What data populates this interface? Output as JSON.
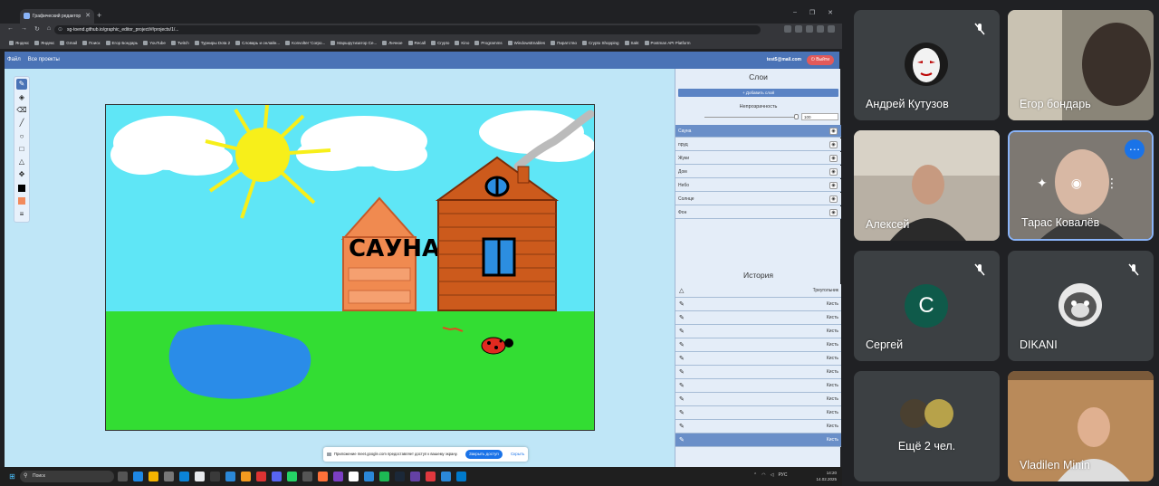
{
  "browser": {
    "tab_title": "Графический редактор",
    "url": "sg-toend.github.io/graphic_editor_project/#/projects/1/...",
    "bookmarks": [
      "Яндекс",
      "Яндекс",
      "Gmail",
      "Поиск",
      "Егор Бондарь",
      "YouTube",
      "Twitch",
      "Турниры Dota 2",
      "Словарь и онлайн...",
      "Konvolter 'Corpo...",
      "Маршрутизатор Се...",
      "Личное",
      "Recall",
      "Crypto",
      "Kino",
      "Programms",
      "WindowsEnables",
      "Пиратство",
      "Crypto Shopping",
      "Sakt",
      "Postman API Platform"
    ]
  },
  "app": {
    "menu": [
      "Файл",
      "Все проекты"
    ],
    "user_email": "test5@mail.com",
    "logout_label": "Выйти"
  },
  "toolbar": {
    "tools": [
      "brush-icon",
      "fill-icon",
      "eraser-icon",
      "line-icon",
      "circle-icon",
      "rectangle-icon",
      "triangle-icon",
      "move-icon",
      "primary-color",
      "secondary-color",
      "menu-icon"
    ],
    "primary_color": "#000000",
    "secondary_color": "#f28a5c"
  },
  "drawing": {
    "sauna_text": "САУНА"
  },
  "layers_panel": {
    "title": "Слои",
    "add_layer_label": "+ Добавить слой",
    "opacity_label": "Непрозрачность",
    "opacity_value": "100",
    "layers": [
      {
        "name": "Сауна",
        "selected": true
      },
      {
        "name": "пруд",
        "selected": false
      },
      {
        "name": "Жуки",
        "selected": false
      },
      {
        "name": "Дом",
        "selected": false
      },
      {
        "name": "Небо",
        "selected": false
      },
      {
        "name": "Солнце",
        "selected": false
      },
      {
        "name": "Фон",
        "selected": false
      }
    ]
  },
  "history_panel": {
    "title": "История",
    "items": [
      {
        "label": "Треугольник",
        "icon": "triangle-icon"
      },
      {
        "label": "Кисть",
        "icon": "brush-icon"
      },
      {
        "label": "Кисть",
        "icon": "brush-icon"
      },
      {
        "label": "Кисть",
        "icon": "brush-icon"
      },
      {
        "label": "Кисть",
        "icon": "brush-icon"
      },
      {
        "label": "Кисть",
        "icon": "brush-icon"
      },
      {
        "label": "Кисть",
        "icon": "brush-icon"
      },
      {
        "label": "Кисть",
        "icon": "brush-icon"
      },
      {
        "label": "Кисть",
        "icon": "brush-icon"
      },
      {
        "label": "Кисть",
        "icon": "brush-icon"
      },
      {
        "label": "Кисть",
        "icon": "brush-icon"
      },
      {
        "label": "Кисть",
        "icon": "brush-icon"
      }
    ]
  },
  "share_toast": {
    "message": "Приложение meet.google.com предоставляет доступ к вашему экрану.",
    "stop_label": "Закрыть доступ",
    "hide_label": "Скрыть"
  },
  "taskbar": {
    "search_placeholder": "Поиск",
    "time": "14:20",
    "date": "14.02.2025",
    "lang": "РУС"
  },
  "meeting": {
    "participants": [
      {
        "name": "Андрей Кутузов",
        "muted": true
      },
      {
        "name": "Егор бондарь",
        "muted": false
      },
      {
        "name": "Алексей",
        "muted": false
      },
      {
        "name": "Тарас Ковалёв",
        "muted": false
      },
      {
        "name": "Сергей",
        "muted": true,
        "initial": "С"
      },
      {
        "name": "DIKANI",
        "muted": true
      },
      {
        "name": "Ещё 2 чел.",
        "muted": false
      },
      {
        "name": "Vladilen Minin",
        "muted": false
      }
    ]
  }
}
